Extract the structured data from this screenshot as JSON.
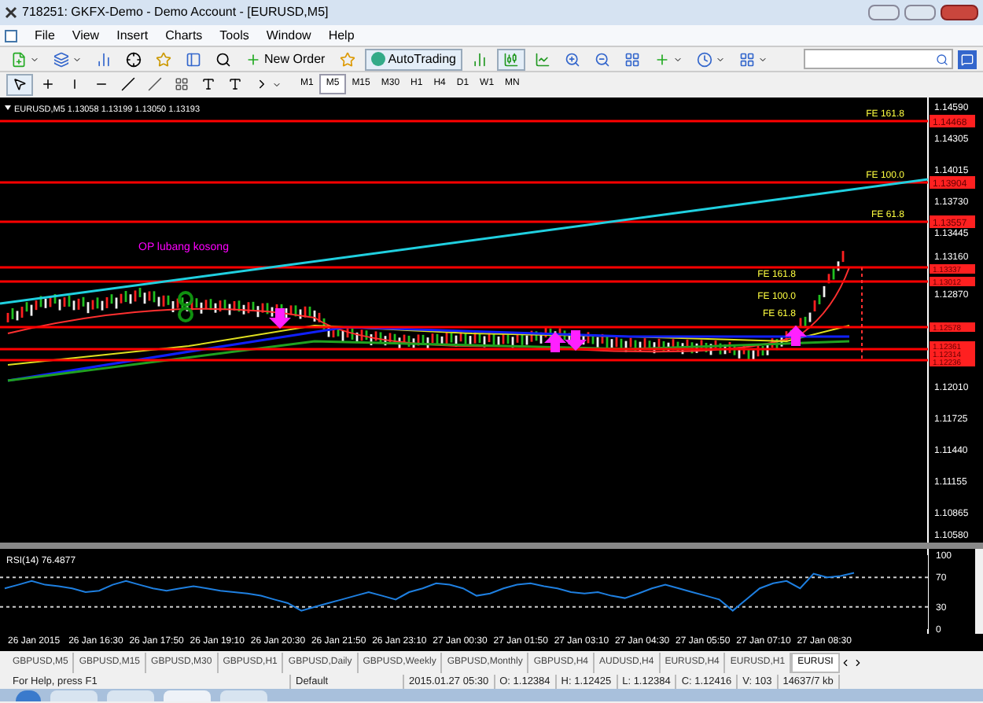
{
  "window": {
    "title": "718251: GKFX-Demo - Demo Account - [EURUSD,M5]"
  },
  "menu": [
    "File",
    "View",
    "Insert",
    "Charts",
    "Tools",
    "Window",
    "Help"
  ],
  "toolbar": {
    "new_order": "New Order",
    "autotrading": "AutoTrading"
  },
  "timeframes": [
    {
      "label": "M1",
      "selected": false
    },
    {
      "label": "M5",
      "selected": true
    },
    {
      "label": "M15",
      "selected": false
    },
    {
      "label": "M30",
      "selected": false
    },
    {
      "label": "H1",
      "selected": false
    },
    {
      "label": "H4",
      "selected": false
    },
    {
      "label": "D1",
      "selected": false
    },
    {
      "label": "W1",
      "selected": false
    },
    {
      "label": "MN",
      "selected": false
    }
  ],
  "chart": {
    "header": "EURUSD,M5  1.13058 1.13199 1.13050 1.13193",
    "note": "OP lubang kosong",
    "price_ticks": [
      "1.14590",
      "1.14305",
      "1.14015",
      "1.13730",
      "1.13445",
      "1.13160",
      "1.12870",
      "1.12010",
      "1.11725",
      "1.11440",
      "1.11155",
      "1.10865",
      "1.10580"
    ],
    "levels": [
      {
        "label": "FE 161.8",
        "tag": "1.14468"
      },
      {
        "label": "FE 100.0",
        "tag": "1.13904"
      },
      {
        "label": "FE 61.8",
        "tag": "1.13557"
      }
    ],
    "inner_levels": [
      {
        "label": "FE 161.8"
      },
      {
        "label": "FE 100.0"
      },
      {
        "label": "FE 61.8"
      }
    ],
    "line_tags": [
      "1.13337",
      "1.13012",
      "1.12578",
      "1.12361",
      "1.12314",
      "1.12236"
    ]
  },
  "rsi": {
    "chart_data": {
      "type": "line",
      "title": "RSI(14) 76.4877",
      "ylim": [
        0,
        100
      ],
      "yticks": [
        100,
        70,
        30,
        0
      ],
      "series": [
        {
          "color": "#1e7fe0",
          "values": [
            55,
            60,
            65,
            60,
            58,
            55,
            50,
            52,
            60,
            65,
            60,
            55,
            52,
            55,
            58,
            55,
            52,
            50,
            48,
            45,
            40,
            35,
            25,
            30,
            35,
            40,
            45,
            50,
            45,
            40,
            50,
            55,
            62,
            60,
            55,
            45,
            48,
            55,
            60,
            62,
            58,
            55,
            50,
            48,
            50,
            45,
            42,
            48,
            55,
            60,
            55,
            50,
            45,
            40,
            25,
            40,
            55,
            62,
            65,
            55,
            75,
            70,
            72,
            76
          ]
        }
      ]
    }
  },
  "time_axis": [
    "26 Jan 2015",
    "26 Jan 16:30",
    "26 Jan 17:50",
    "26 Jan 19:10",
    "26 Jan 20:30",
    "26 Jan 21:50",
    "26 Jan 23:10",
    "27 Jan 00:30",
    "27 Jan 01:50",
    "27 Jan 03:10",
    "27 Jan 04:30",
    "27 Jan 05:50",
    "27 Jan 07:10",
    "27 Jan 08:30"
  ],
  "chart_tabs": [
    {
      "label": "GBPUSD,M5",
      "selected": false
    },
    {
      "label": "GBPUSD,M15",
      "selected": false
    },
    {
      "label": "GBPUSD,M30",
      "selected": false
    },
    {
      "label": "GBPUSD,H1",
      "selected": false
    },
    {
      "label": "GBPUSD,Daily",
      "selected": false
    },
    {
      "label": "GBPUSD,Weekly",
      "selected": false
    },
    {
      "label": "GBPUSD,Monthly",
      "selected": false
    },
    {
      "label": "GBPUSD,H4",
      "selected": false
    },
    {
      "label": "AUDUSD,H4",
      "selected": false
    },
    {
      "label": "EURUSD,H4",
      "selected": false
    },
    {
      "label": "EURUSD,H1",
      "selected": false
    },
    {
      "label": "EURUSI",
      "selected": true
    }
  ],
  "status_bar": [
    "For Help, press F1",
    "Default",
    "2015.01.27 05:30",
    "O: 1.12384",
    "H: 1.12425",
    "L: 1.12384",
    "C: 1.12416",
    "V: 103",
    "14637/7 kb"
  ]
}
